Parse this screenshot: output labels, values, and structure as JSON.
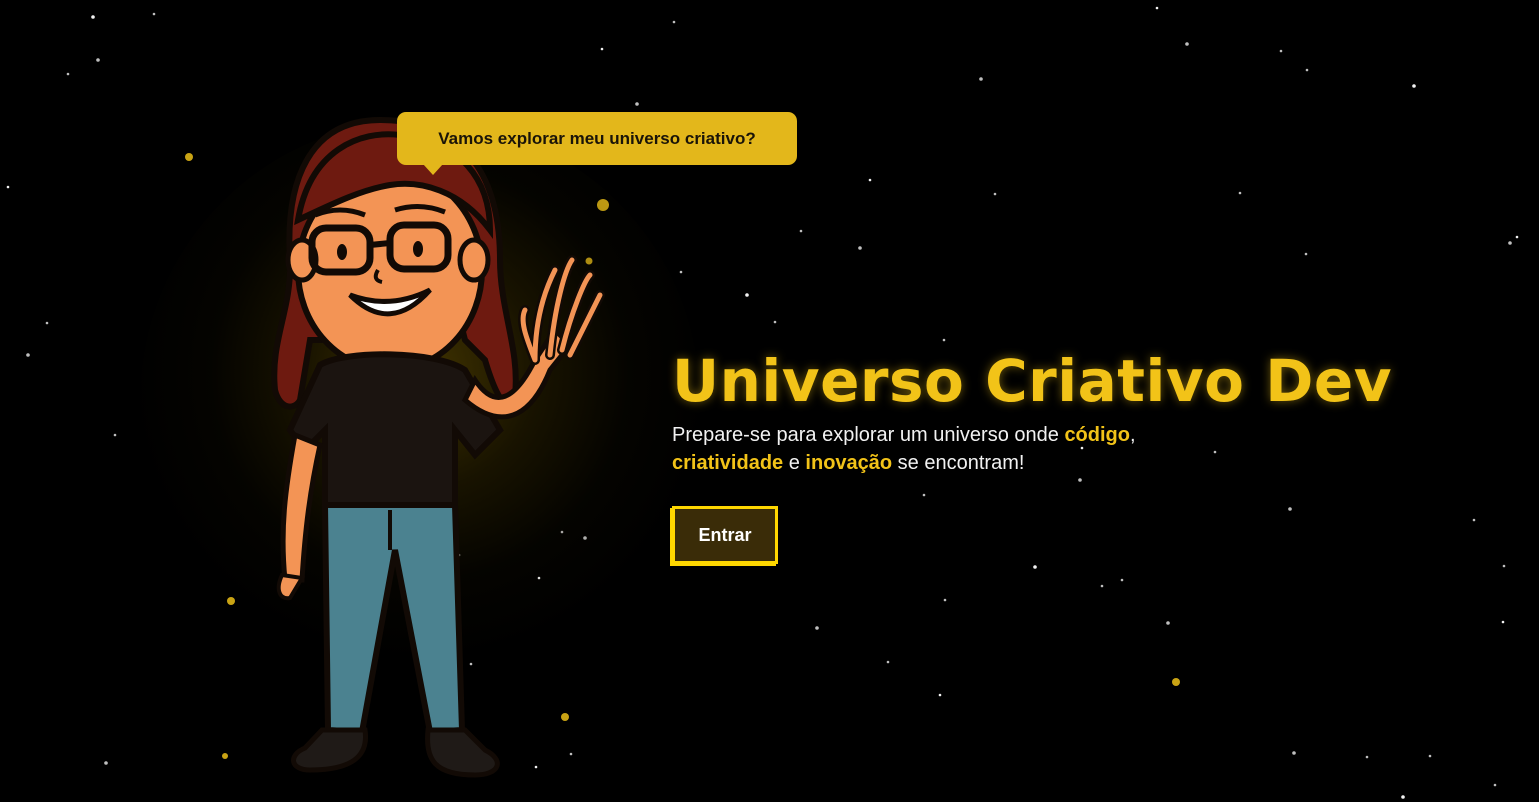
{
  "speech_bubble": {
    "text": "Vamos explorar meu universo criativo?"
  },
  "hero": {
    "title": "Universo Criativo Dev",
    "tagline": {
      "part1": "Prepare-se para explorar um universo onde ",
      "highlight1": "código",
      "part2": ",",
      "highlight2": "criatividade",
      "part3": " e ",
      "highlight3": "inovação",
      "part4": " se encontram!"
    },
    "enter_button": "Entrar"
  },
  "colors": {
    "background": "#000000",
    "accent": "#F2C318",
    "bubble": "#E3B71B",
    "button_bg": "#3a2c08",
    "button_border": "#FFD700",
    "star": "#ffffff",
    "gold_star": "#C9A314"
  },
  "icons": {
    "avatar": "waving-girl-illustration"
  }
}
